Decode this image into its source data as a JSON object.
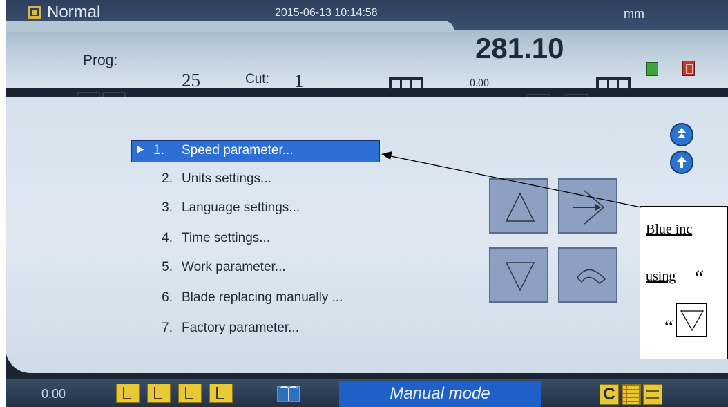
{
  "header": {
    "mode": "Normal",
    "datetime": "2015-06-13  10:14:58",
    "unit_top": "mm",
    "prog_label": "Prog:",
    "prog_value": "25",
    "cut_label": "Cut:",
    "cut_value": "1",
    "position_value": "281.10",
    "offset_value": "0.00"
  },
  "menu": {
    "items": [
      {
        "num": "1.",
        "label": "Speed parameter...",
        "selected": true
      },
      {
        "num": "2.",
        "label": "Units settings..."
      },
      {
        "num": "3.",
        "label": "Language settings..."
      },
      {
        "num": "4.",
        "label": "Time settings..."
      },
      {
        "num": "5.",
        "label": "Work parameter..."
      },
      {
        "num": "6.",
        "label": "Blade replacing manually ..."
      },
      {
        "num": "7.",
        "label": "Factory parameter..."
      }
    ],
    "selection_marker": "►"
  },
  "nav_buttons": [
    "up-arrow-icon",
    "enter-arrow-icon",
    "down-arrow-icon",
    "back-arrow-icon"
  ],
  "annotation": {
    "line1": "Blue   inc",
    "line2": "using",
    "quote_open": "“",
    "quote_open2": "“"
  },
  "bottom": {
    "value": "0.00",
    "mode": "Manual mode",
    "c_label": "C"
  },
  "colors": {
    "highlight": "#2e6fd6",
    "accent_yellow": "#e6c934",
    "mode_bar": "#1f5fc8"
  }
}
